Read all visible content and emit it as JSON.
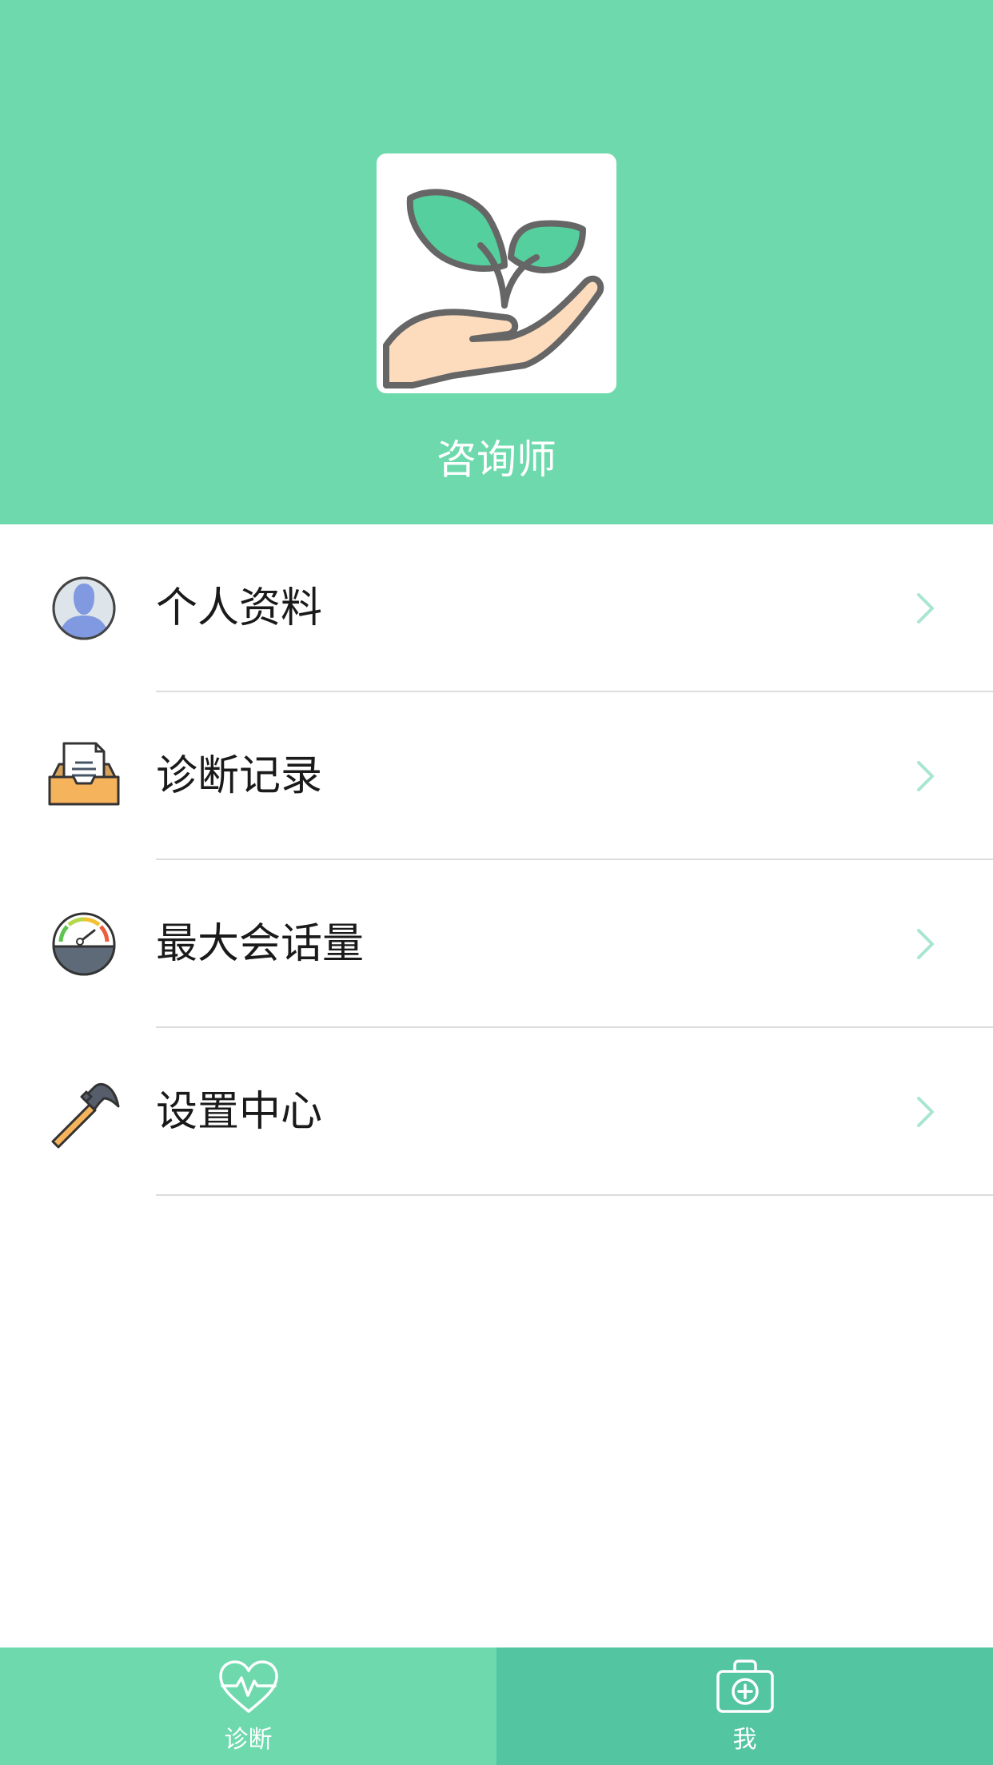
{
  "profile": {
    "name": "咨询师",
    "avatar_icon": "plant-in-hand-icon"
  },
  "menu": {
    "items": [
      {
        "label": "个人资料",
        "icon": "user-avatar-icon"
      },
      {
        "label": "诊断记录",
        "icon": "document-tray-icon"
      },
      {
        "label": "最大会话量",
        "icon": "speedometer-icon"
      },
      {
        "label": "设置中心",
        "icon": "hammer-icon"
      }
    ]
  },
  "tabbar": {
    "tabs": [
      {
        "label": "诊断",
        "icon": "heart-pulse-icon",
        "active": false
      },
      {
        "label": "我",
        "icon": "medical-kit-icon",
        "active": true
      }
    ]
  },
  "colors": {
    "accent": "#6dd9ad",
    "accent_dark": "#53c5a0",
    "chevron": "#a8e6cf",
    "divider": "#dcdcdc"
  }
}
